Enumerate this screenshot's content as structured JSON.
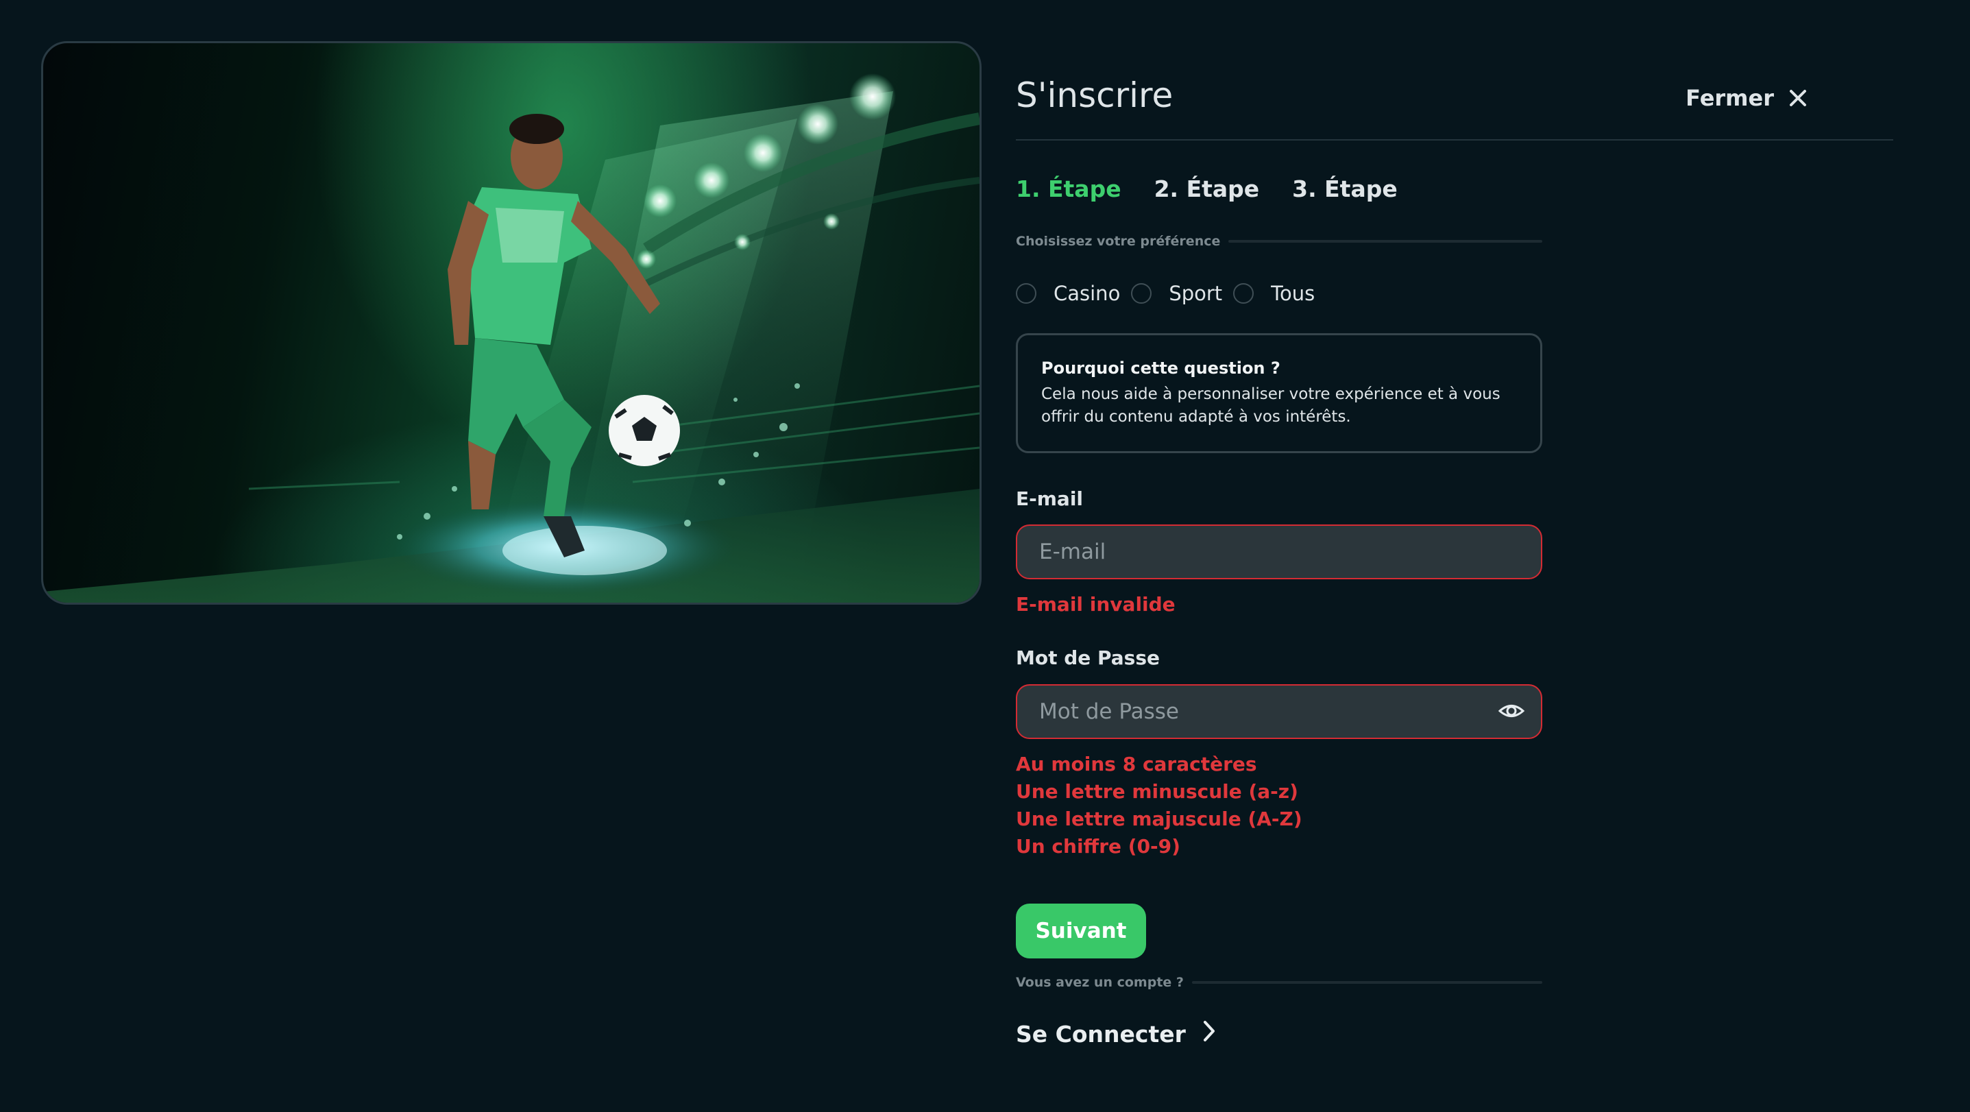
{
  "hero": {
    "image_description": "soccer-player-stadium-artwork"
  },
  "header": {
    "title": "S'inscrire",
    "close_label": "Fermer"
  },
  "steps": [
    {
      "label": "1. Étape",
      "active": true
    },
    {
      "label": "2. Étape",
      "active": false
    },
    {
      "label": "3. Étape",
      "active": false
    }
  ],
  "preference": {
    "label": "Choisissez votre préférence",
    "options": [
      "Casino",
      "Sport",
      "Tous"
    ],
    "selected": null
  },
  "info": {
    "title": "Pourquoi cette question ?",
    "text": "Cela nous aide à personnaliser votre expérience et à vous offrir du contenu adapté à vos intérêts."
  },
  "email": {
    "label": "E-mail",
    "value": "",
    "placeholder": "E-mail",
    "error": "E-mail invalide"
  },
  "password": {
    "label": "Mot de Passe",
    "value": "",
    "placeholder": "Mot de Passe",
    "rules": [
      "Au moins 8 caractères",
      "Une lettre minuscule (a-z)",
      "Une lettre majuscule (A-Z)",
      "Un chiffre (0-9)"
    ]
  },
  "actions": {
    "next_label": "Suivant",
    "account_prompt": "Vous avez un compte ?",
    "login_label": "Se Connecter"
  },
  "colors": {
    "background": "#06151c",
    "accent_green": "#3ecf6e",
    "error_red": "#e0383c",
    "input_bg": "#2b363b"
  }
}
